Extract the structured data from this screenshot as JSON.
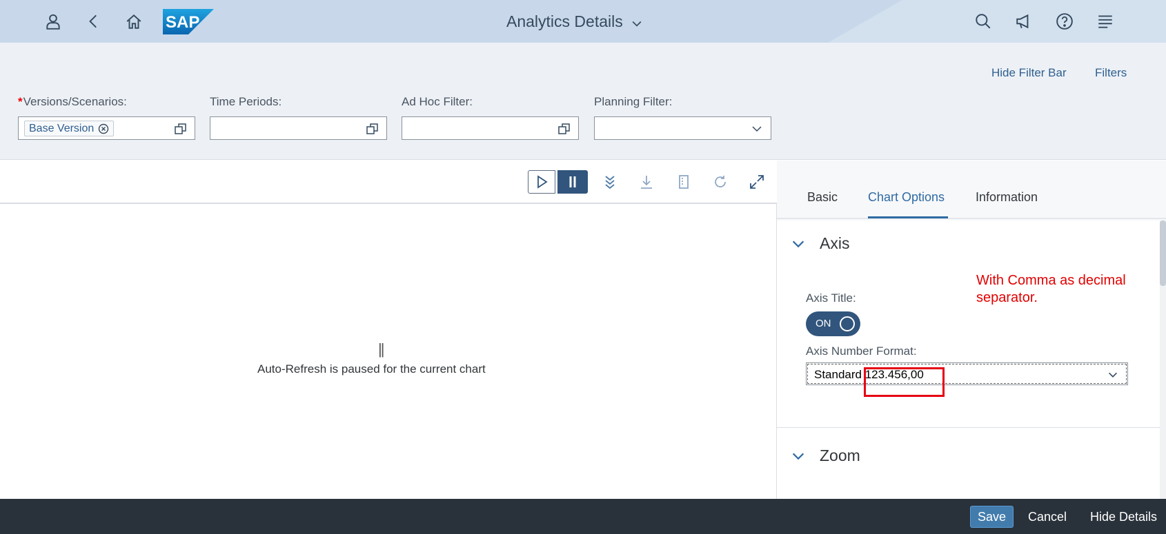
{
  "shell": {
    "title": "Analytics Details",
    "logo_text": "SAP",
    "icons": [
      "user-icon",
      "back-icon",
      "home-icon",
      "search-icon",
      "notification-icon",
      "help-icon",
      "menu-icon"
    ]
  },
  "filter_bar": {
    "hide_filter_bar_label": "Hide Filter Bar",
    "filters_label": "Filters",
    "fields": [
      {
        "label": "Versions/Scenarios:",
        "required": "*",
        "token": "Base Version"
      },
      {
        "label": "Time Periods:"
      },
      {
        "label": "Ad Hoc Filter:"
      },
      {
        "label": "Planning Filter:"
      }
    ]
  },
  "chart": {
    "paused_symbol": "||",
    "paused_message": "Auto-Refresh is paused for the current chart"
  },
  "details": {
    "tabs": [
      {
        "label": "Basic"
      },
      {
        "label": "Chart Options",
        "active": true
      },
      {
        "label": "Information"
      }
    ],
    "axis_section": {
      "title": "Axis",
      "axis_title_label": "Axis Title:",
      "toggle_label": "ON",
      "number_format_label": "Axis Number Format:",
      "number_format_value": "Standard 123.456,00"
    },
    "zoom_section": {
      "title": "Zoom"
    },
    "annotation": "With Comma as decimal separator."
  },
  "footer": {
    "save_label": "Save",
    "cancel_label": "Cancel",
    "hide_details_label": "Hide Details"
  },
  "colors": {
    "shell_bg": "#c8d8ea",
    "accent": "#2f6aa3",
    "footer_bg": "#29313a",
    "annotation": "#e20000"
  }
}
